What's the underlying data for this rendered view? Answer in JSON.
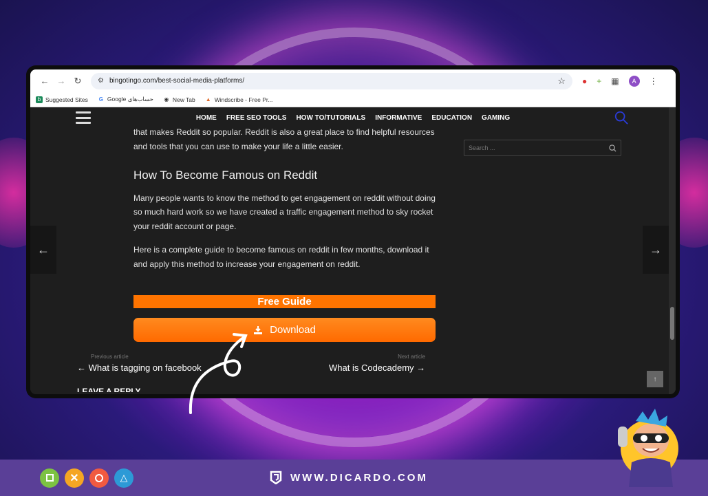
{
  "browser": {
    "url": "bingotingo.com/best-social-media-platforms/",
    "profile_initial": "A",
    "bookmarks": [
      {
        "label": "Suggested Sites"
      },
      {
        "label": "Google حساب‌های"
      },
      {
        "label": "New Tab"
      },
      {
        "label": "Windscribe - Free Pr..."
      }
    ]
  },
  "site": {
    "nav": [
      "HOME",
      "FREE SEO TOOLS",
      "HOW TO/TUTORIALS",
      "INFORMATIVE",
      "EDUCATION",
      "GAMING"
    ],
    "search_placeholder": "Search ..."
  },
  "article": {
    "intro_p": "that makes Reddit so popular. Reddit is also a great place to find helpful resources and tools that you can use to make your life a little easier.",
    "heading": "How To Become Famous on Reddit",
    "p1": "Many people wants to know the method to get engagement on reddit without doing so much hard work so we have created a traffic engagement method to sky rocket your reddit account or page.",
    "p2": "Here is a complete guide to become famous on reddit in few months, download it and apply this method to increase your engagement on reddit.",
    "free_guide": "Free Guide",
    "download": "Download"
  },
  "article_nav": {
    "prev_label": "Previous article",
    "prev_title": "What is tagging on facebook",
    "next_label": "Next article",
    "next_title": "What is Codecademy"
  },
  "leave_reply": "LEAVE A REPLY",
  "footer": {
    "brand": "WWW.DICARDO.COM"
  },
  "colors": {
    "accent": "#ff7400",
    "bar": "#5a3f97"
  }
}
